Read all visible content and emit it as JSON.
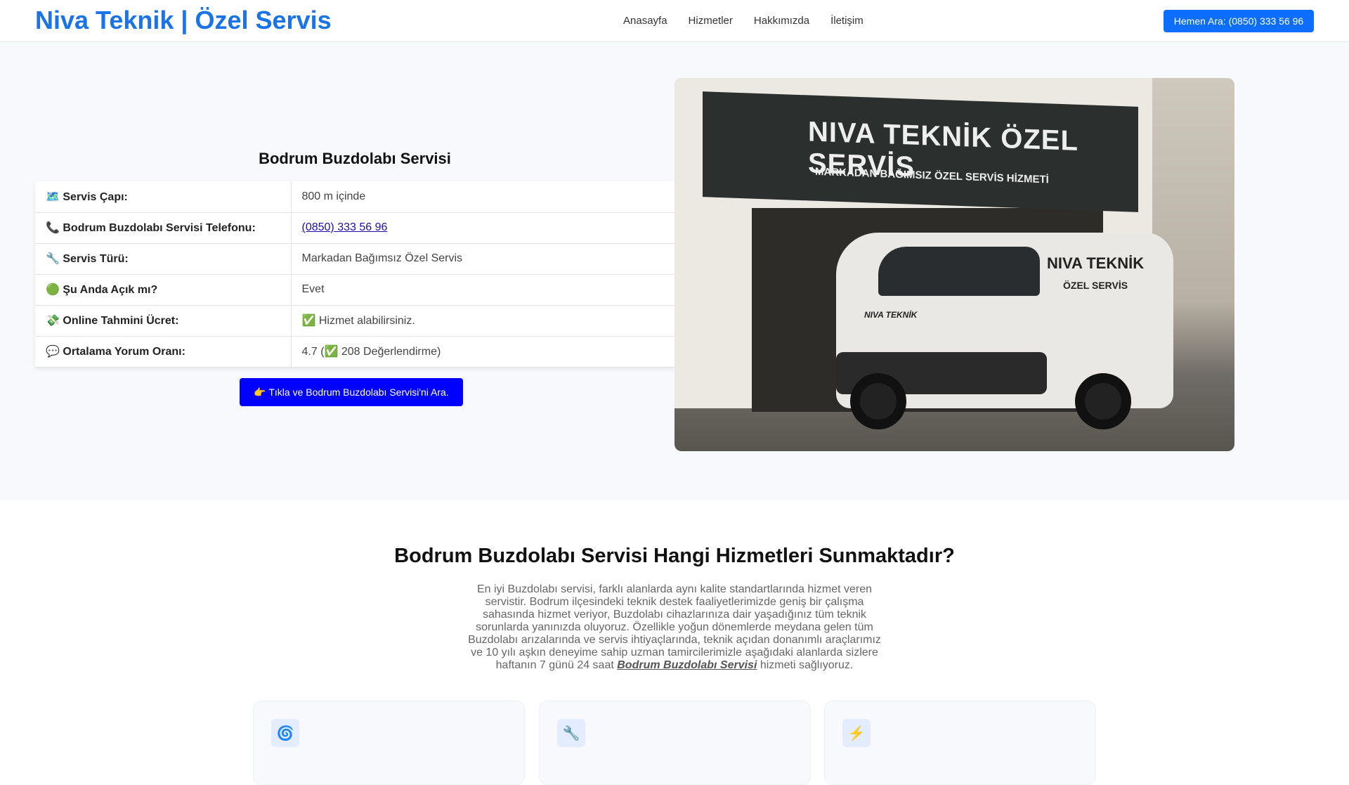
{
  "header": {
    "brand": "Niva Teknik | Özel Servis",
    "nav": [
      "Anasayfa",
      "Hizmetler",
      "Hakkımızda",
      "İletişim"
    ],
    "call_button": "Hemen Ara: (0850) 333 56 96"
  },
  "hero": {
    "title": "Bodrum Buzdolabı Servisi",
    "rows": [
      {
        "icon": "🗺️",
        "label": "Servis Çapı:",
        "value": "800 m içinde"
      },
      {
        "icon": "📞",
        "label": "Bodrum Buzdolabı Servisi Telefonu:",
        "value": "(0850) 333 56 96"
      },
      {
        "icon": "🔧",
        "label": "Servis Türü:",
        "value": "Markadan Bağımsız Özel Servis"
      },
      {
        "icon": "🟢",
        "label": "Şu Anda Açık mı?",
        "value": "Evet"
      },
      {
        "icon": "💸",
        "label": "Online Tahmini Ücret:",
        "value": "✅ Hizmet alabilirsiniz."
      },
      {
        "icon": "💬",
        "label": "Ortalama Yorum Oranı:",
        "value": "4.7 (✅ 208 Değerlendirme)"
      }
    ],
    "cta": "👉 Tıkla ve Bodrum Buzdolabı Servisi'ni Ara.",
    "photo": {
      "sign_title": "NIVA TEKNİK   ÖZEL SERVİS",
      "sign_sub": "MARKADAN BAĞIMSIZ ÖZEL SERVİS HİZMETİ",
      "van_label1": "NIVA TEKNİK",
      "van_label2": "ÖZEL SERVİS",
      "van_hood": "NIVA TEKNİK"
    }
  },
  "services": {
    "title": "Bodrum Buzdolabı Servisi Hangi Hizmetleri Sunmaktadır?",
    "para_before": "En iyi Buzdolabı servisi, farklı alanlarda aynı kalite standartlarında hizmet veren servistir. Bodrum ilçesindeki teknik destek faaliyetlerimizde geniş bir çalışma sahasında hizmet veriyor, Buzdolabı cihazlarınıza dair yaşadığınız tüm teknik sorunlarda yanınızda oluyoruz. Özellikle yoğun dönemlerde meydana gelen tüm Buzdolabı arızalarında ve servis ihtiyaçlarında, teknik açıdan donanımlı araçlarımız ve 10 yılı aşkın deneyime sahip uzman tamircilerimizle aşağıdaki alanlarda sizlere haftanın 7 günü 24 saat ",
    "para_link": "Bodrum Buzdolabı Servisi",
    "para_after": " hizmeti sağlıyoruz.",
    "cards": [
      {
        "icon": "🌀"
      },
      {
        "icon": "🔧"
      },
      {
        "icon": "⚡"
      }
    ]
  }
}
